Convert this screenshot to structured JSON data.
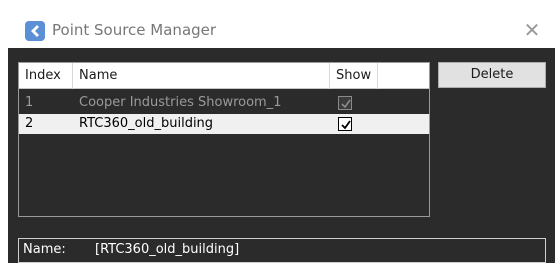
{
  "window": {
    "title": "Point Source Manager",
    "close_icon": "close-icon",
    "app_icon": "app-icon"
  },
  "table": {
    "columns": [
      "Index",
      "Name",
      "Show"
    ],
    "rows": [
      {
        "index": "1",
        "name": "Cooper Industries Showroom_1",
        "show": true,
        "enabled": false
      },
      {
        "index": "2",
        "name": "RTC360_old_building",
        "show": true,
        "enabled": true,
        "selected": true
      }
    ]
  },
  "buttons": {
    "delete_label": "Delete"
  },
  "details": {
    "name_label": "Name:",
    "name_value": "[RTC360_old_building]"
  },
  "colors": {
    "panel_bg": "#2b2b2b",
    "titlebar_bg": "#ffffff",
    "selected_row_bg": "#f0f0f0",
    "disabled_text": "#9a9a9a"
  }
}
